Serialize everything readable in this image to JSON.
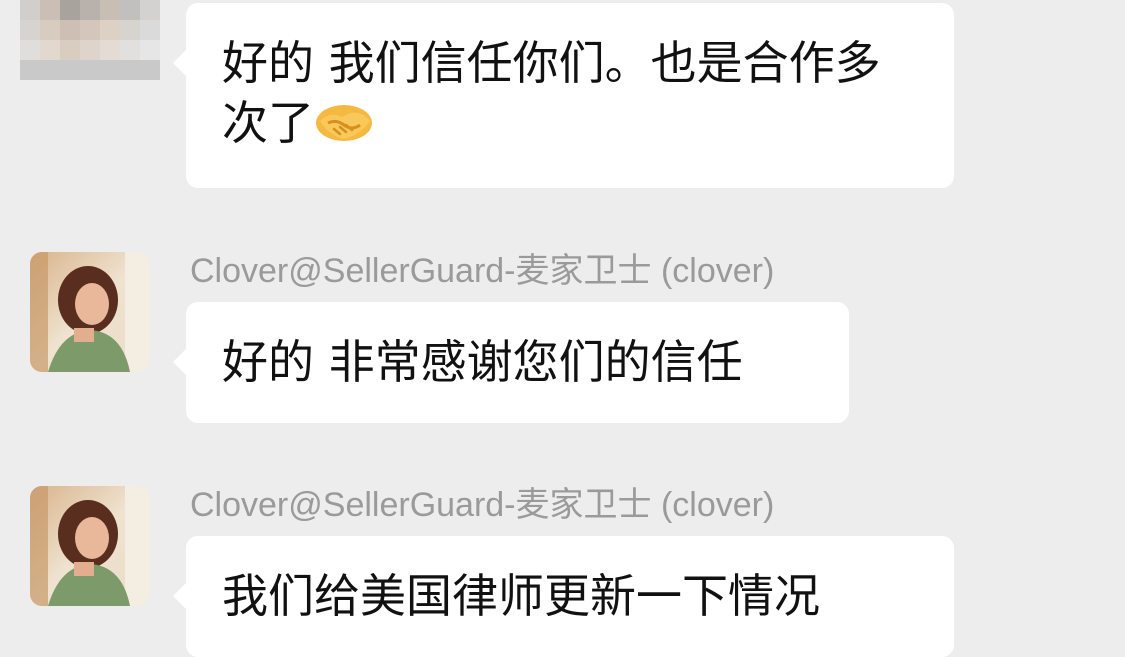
{
  "messages": [
    {
      "sender": "",
      "text": "好的 我们信任你们。也是合作多次了",
      "emoji": "handshake-emoji",
      "avatar": "pixelated-avatar"
    },
    {
      "sender": "Clover@SellerGuard-麦家卫士 (clover)",
      "text": "好的 非常感谢您们的信任",
      "avatar": "photo-avatar"
    },
    {
      "sender": "Clover@SellerGuard-麦家卫士 (clover)",
      "text": "我们给美国律师更新一下情况",
      "avatar": "photo-avatar"
    }
  ],
  "colors": {
    "background": "#EDEDED",
    "bubble": "#FFFFFF",
    "sender_text": "#9A9A9A",
    "message_text": "#111111"
  }
}
